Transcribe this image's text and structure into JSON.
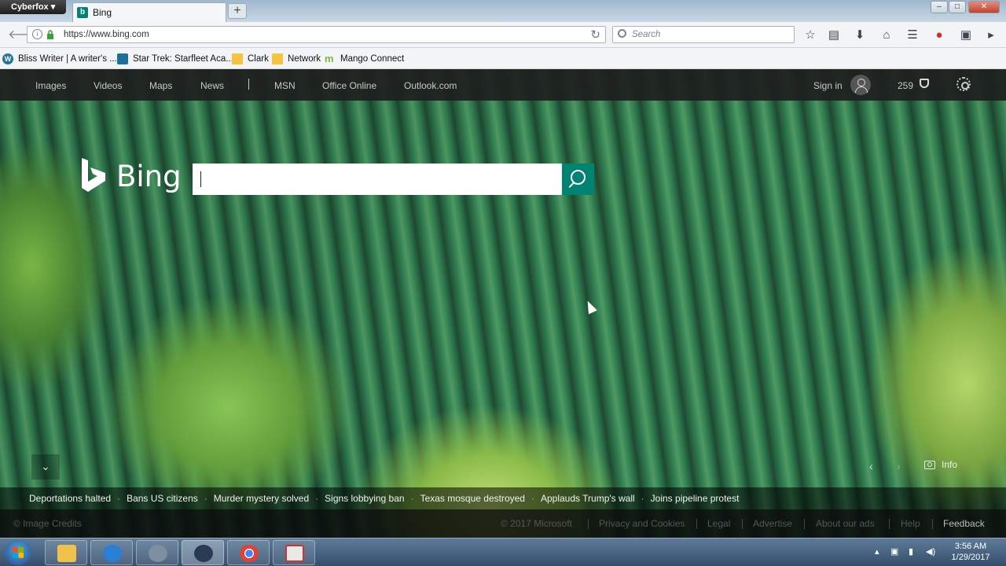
{
  "browser": {
    "menu_button": "Cyberfox",
    "tab_title": "Bing",
    "new_tab_label": "+",
    "url": "https://www.bing.com",
    "search_placeholder": "Search",
    "window_controls": [
      "–",
      "□",
      "✕"
    ]
  },
  "bookmarks": [
    {
      "label": "Bliss Writer | A writer's ...",
      "icon": "wordpress-icon"
    },
    {
      "label": "Star Trek: Starfleet Aca...",
      "icon": "star-trek-icon"
    },
    {
      "label": "Clark",
      "icon": "folder-icon"
    },
    {
      "label": "Network",
      "icon": "folder-icon"
    },
    {
      "label": "Mango Connect",
      "icon": "mango-icon"
    }
  ],
  "bing": {
    "nav": {
      "images": "Images",
      "videos": "Videos",
      "maps": "Maps",
      "news": "News",
      "msn": "MSN",
      "office": "Office Online",
      "outlook": "Outlook.com"
    },
    "sign_in": "Sign in",
    "rewards_count": "259",
    "logo_text": "Bing",
    "search_value": "",
    "accent_color": "#008373",
    "info_label": "Info",
    "news": [
      "Deportations halted",
      "Bans US citizens",
      "Murder mystery solved",
      "Signs lobbying ban",
      "Texas mosque destroyed",
      "Applauds Trump's wall",
      "Joins pipeline protest"
    ],
    "footer": {
      "image_credits": "© Image Credits",
      "copyright": "© 2017 Microsoft",
      "privacy": "Privacy and Cookies",
      "legal": "Legal",
      "advertise": "Advertise",
      "about_ads": "About our ads",
      "help": "Help",
      "feedback": "Feedback"
    }
  },
  "taskbar": {
    "time": "3:56 AM",
    "date": "1/29/2017"
  }
}
